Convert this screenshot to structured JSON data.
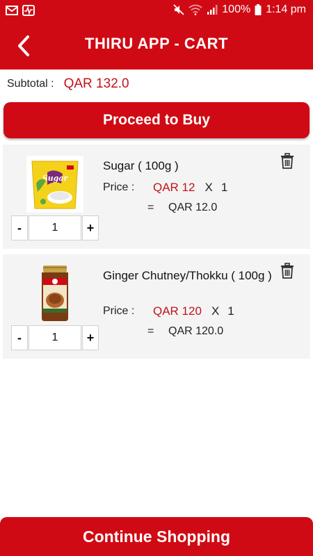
{
  "status_bar": {
    "battery": "100%",
    "time": "1:14 pm",
    "icons": [
      "mail-icon",
      "pulse-icon",
      "mute-icon",
      "wifi-icon",
      "signal-icon",
      "battery-icon"
    ]
  },
  "app_bar": {
    "title": "THIRU APP - CART",
    "back_icon": "back-chevron-icon"
  },
  "summary": {
    "subtotal_label": "Subtotal :",
    "subtotal_value": "QAR 132.0"
  },
  "actions": {
    "proceed_label": "Proceed to Buy",
    "continue_label": "Continue Shopping"
  },
  "items": [
    {
      "name": "Sugar ( 100g  )",
      "price_label": "Price :",
      "unit_price": "QAR 12",
      "times": "X",
      "qty_text": "1",
      "equals": "=",
      "line_total": "QAR 12.0",
      "minus": "-",
      "qty_value": "1",
      "plus": "+",
      "product_image": "sugar-pack",
      "package_text": "Sugar",
      "delete_icon": "trash-icon"
    },
    {
      "name": "Ginger Chutney/Thokku ( 100g  )",
      "price_label": "Price :",
      "unit_price": "QAR 120",
      "times": "X",
      "qty_text": "1",
      "equals": "=",
      "line_total": "QAR 120.0",
      "minus": "-",
      "qty_value": "1",
      "plus": "+",
      "product_image": "chutney-jar",
      "delete_icon": "trash-icon"
    }
  ],
  "colors": {
    "brand_red": "#d00a14",
    "price_red": "#c4121a",
    "card_bg": "#f4f4f4"
  }
}
